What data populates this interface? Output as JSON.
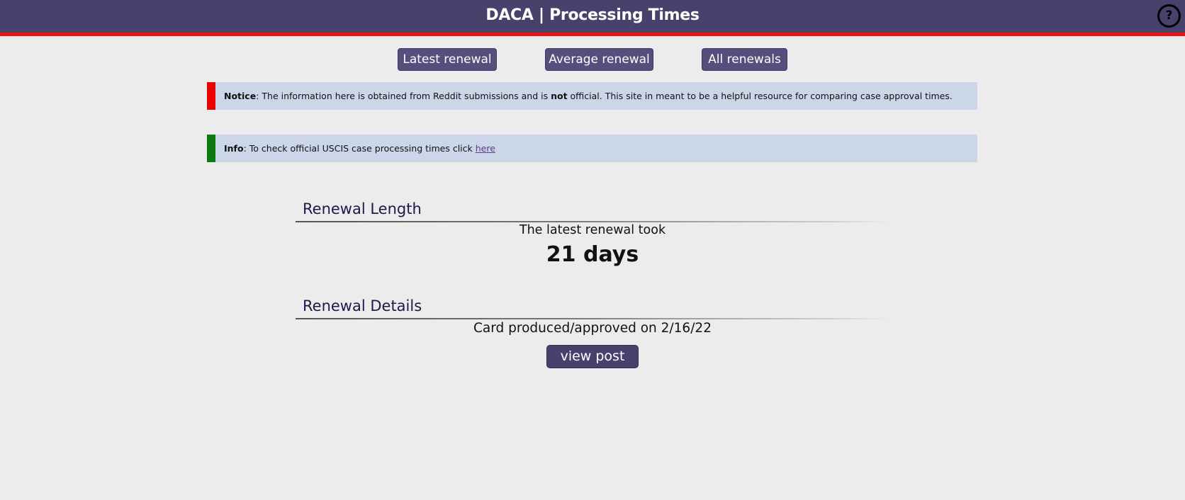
{
  "header": {
    "title": "DACA | Processing Times",
    "help_label": "?"
  },
  "nav": {
    "latest_label": "Latest renewal",
    "average_label": "Average renewal",
    "all_label": "All renewals"
  },
  "notice": {
    "label": "Notice",
    "text_before_bold": ": The information here is obtained from Reddit submissions and is ",
    "bold_word": "not",
    "text_after_bold": " official. This site in meant to be a helpful resource for comparing case approval times."
  },
  "info": {
    "label": "Info",
    "text": ": To check official USCIS case processing times click ",
    "link_text": "here"
  },
  "renewal_length": {
    "title": "Renewal Length",
    "caption": "The latest renewal took",
    "value": "21 days"
  },
  "renewal_details": {
    "title": "Renewal Details",
    "approved_text": "Card produced/approved on 2/16/22",
    "view_post_label": "view post"
  },
  "colors": {
    "header_bg": "#47426c",
    "header_border": "#ee1111",
    "notice_bar": "#ee0000",
    "info_bar": "#0c7a10",
    "alert_bg": "#cbd6e8",
    "button_bg": "#544f7c"
  },
  "icons": {
    "help": "help-icon"
  }
}
